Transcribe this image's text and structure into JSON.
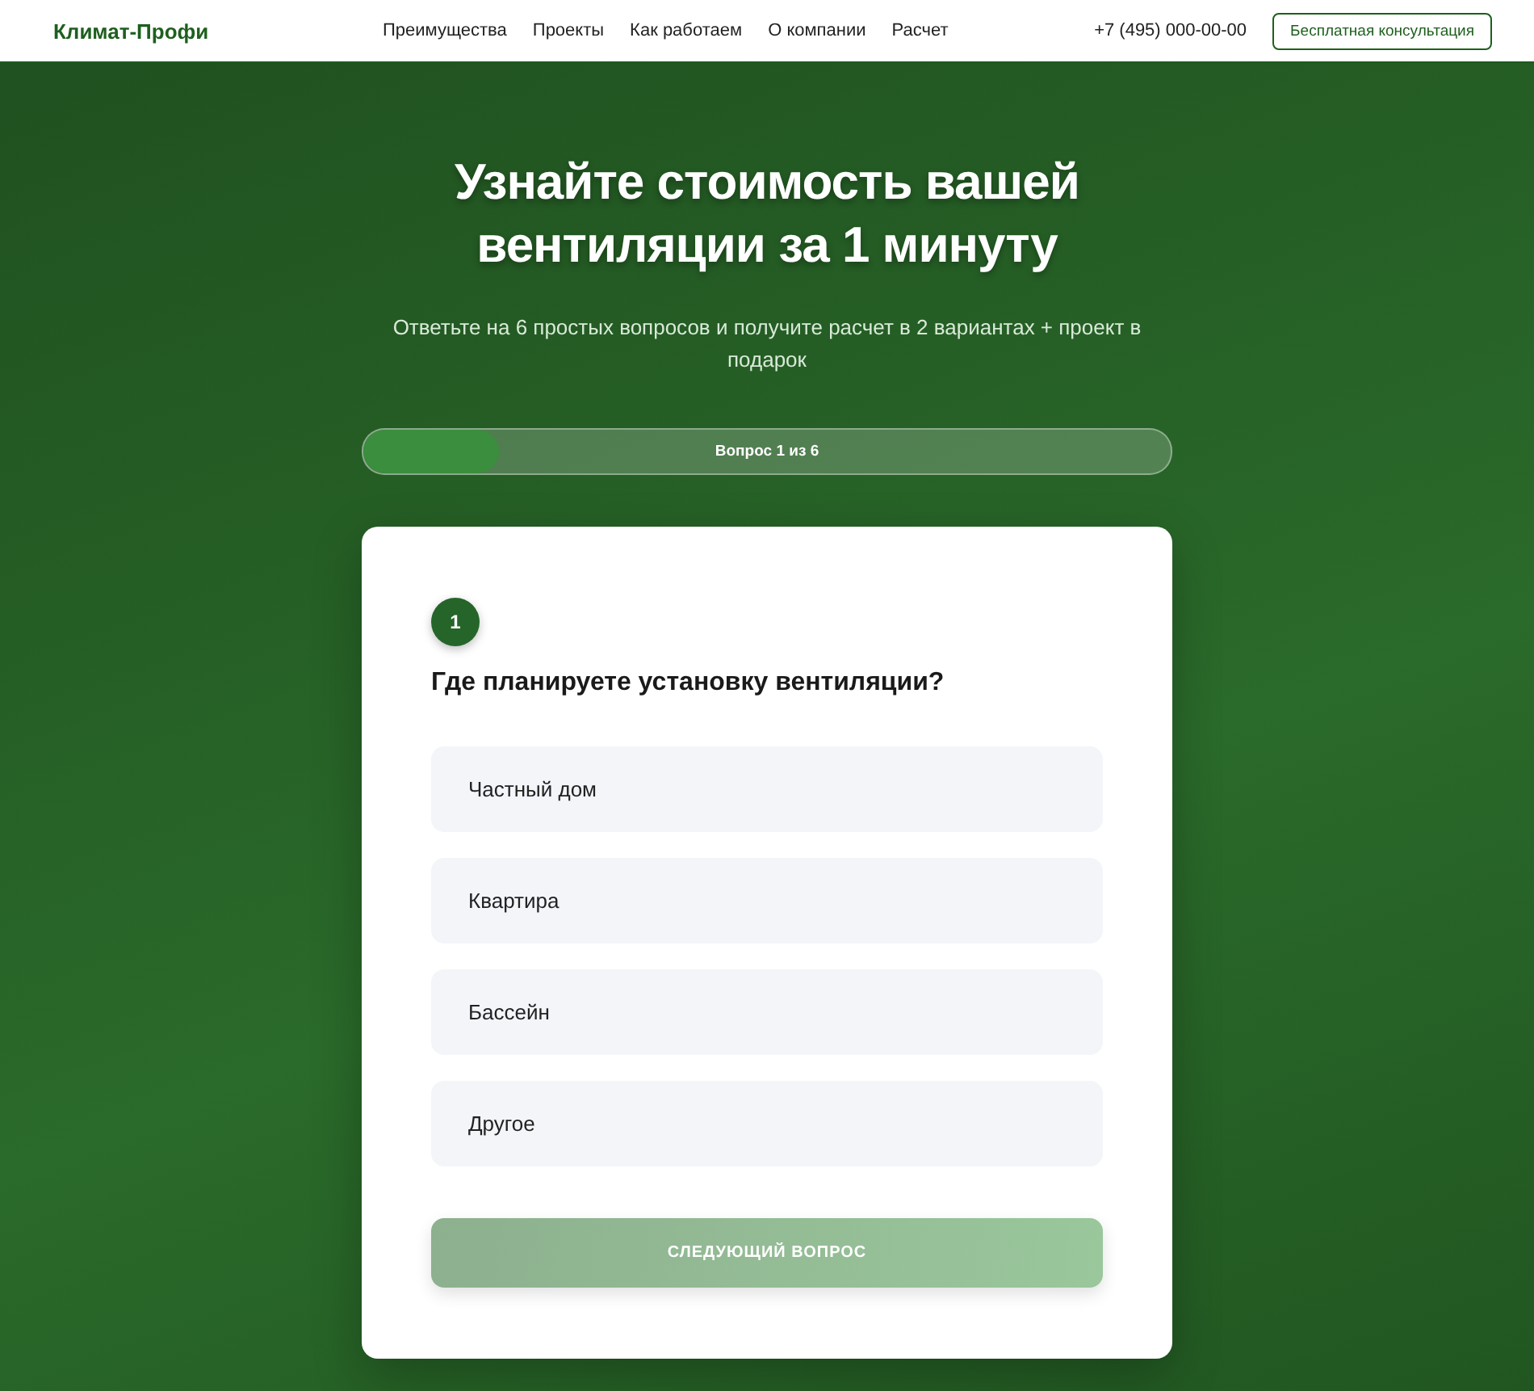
{
  "header": {
    "logo": "Климат-Профи",
    "nav": [
      "Преимущества",
      "Проекты",
      "Как работаем",
      "О компании",
      "Расчет"
    ],
    "phone": "+7 (495) 000-00-00",
    "cta": "Бесплатная консультация"
  },
  "hero": {
    "title": "Узнайте стоимость вашей вентиляции за 1 минуту",
    "subtitle": "Ответьте на 6 простых вопросов и получите расчет в 2 вариантах + проект в подарок"
  },
  "progress": {
    "label": "Вопрос 1 из 6",
    "level": 0.167
  },
  "quiz": {
    "step": "1",
    "question": "Где планируете установку вентиляции?",
    "options": [
      {
        "label": "Частный дом",
        "selected": false
      },
      {
        "label": "Квартира",
        "selected": false
      },
      {
        "label": "Бассейн",
        "selected": false
      },
      {
        "label": "Другое",
        "selected": false
      }
    ],
    "next_button": {
      "label": "СЛЕДУЮЩИЙ ВОПРОС",
      "disabled": true
    }
  }
}
